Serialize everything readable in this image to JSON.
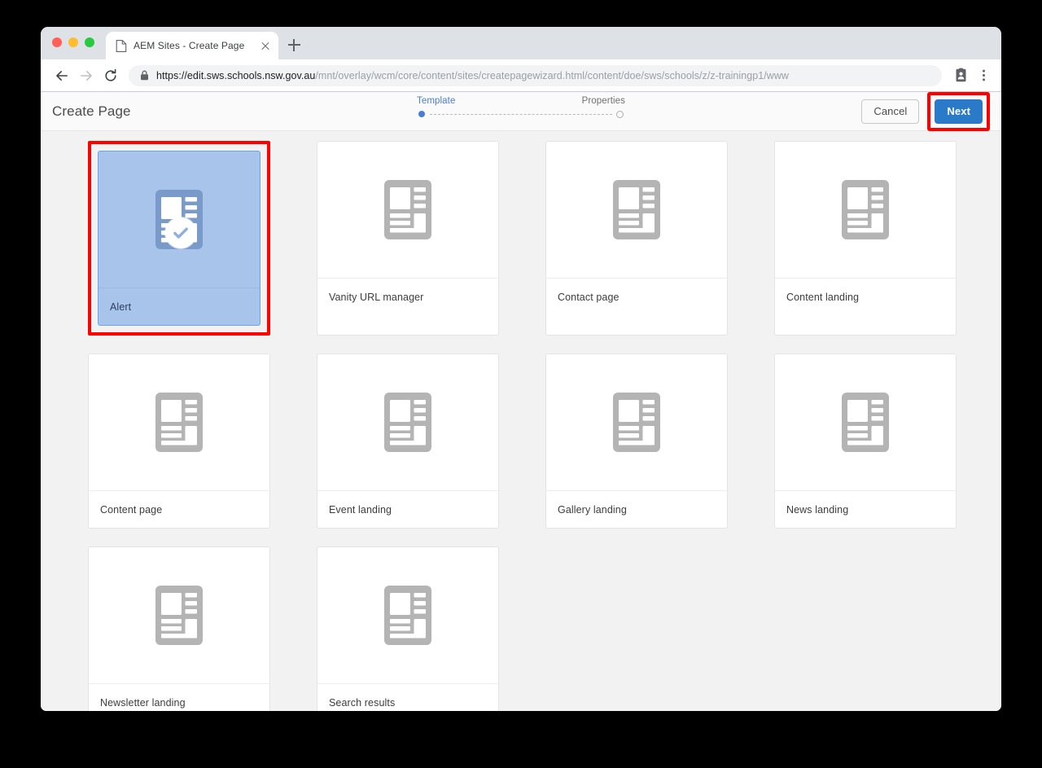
{
  "browser": {
    "tab": {
      "title": "AEM Sites - Create Page",
      "favicon_icon": "page-icon",
      "close_icon": "close-icon"
    },
    "new_tab_icon": "plus-icon",
    "back_icon": "arrow-back-icon",
    "forward_icon": "arrow-forward-icon",
    "reload_icon": "reload-icon",
    "lock_icon": "lock-icon",
    "url": "https://edit.sws.schools.nsw.gov.au/mnt/overlay/wcm/core/content/sites/createpagewizard.html/content/doe/sws/schools/z/z-trainingp1/www",
    "url_host": "https://edit.sws.schools.nsw.gov.au",
    "url_path": "/mnt/overlay/wcm/core/content/sites/createpagewizard.html/content/doe/sws/schools/z/z-trainingp1/www",
    "profile_icon": "profile-card-icon",
    "menu_icon": "three-dot-menu-icon",
    "traffic_lights": {
      "close_color": "#ff5f57",
      "minimize_color": "#febc2e",
      "maximize_color": "#28c840"
    }
  },
  "header": {
    "title": "Create Page",
    "stepper": {
      "steps": [
        {
          "label": "Template",
          "state": "active"
        },
        {
          "label": "Properties",
          "state": "inactive"
        }
      ],
      "active_color": "#4a7dd6"
    },
    "cancel_label": "Cancel",
    "next_label": "Next",
    "next_color": "#2a7ac9",
    "annotation_color": "#ff0000"
  },
  "templates": [
    {
      "name": "Alert",
      "selected": true,
      "icon": "template-thumbnail-icon",
      "check_icon": "check-circle-icon"
    },
    {
      "name": "Vanity URL manager",
      "selected": false,
      "icon": "template-thumbnail-icon"
    },
    {
      "name": "Contact page",
      "selected": false,
      "icon": "template-thumbnail-icon"
    },
    {
      "name": "Content landing",
      "selected": false,
      "icon": "template-thumbnail-icon"
    },
    {
      "name": "Content page",
      "selected": false,
      "icon": "template-thumbnail-icon"
    },
    {
      "name": "Event landing",
      "selected": false,
      "icon": "template-thumbnail-icon"
    },
    {
      "name": "Gallery landing",
      "selected": false,
      "icon": "template-thumbnail-icon"
    },
    {
      "name": "News landing",
      "selected": false,
      "icon": "template-thumbnail-icon"
    },
    {
      "name": "Newsletter landing",
      "selected": false,
      "icon": "template-thumbnail-icon"
    },
    {
      "name": "Search results",
      "selected": false,
      "icon": "template-thumbnail-icon"
    }
  ]
}
